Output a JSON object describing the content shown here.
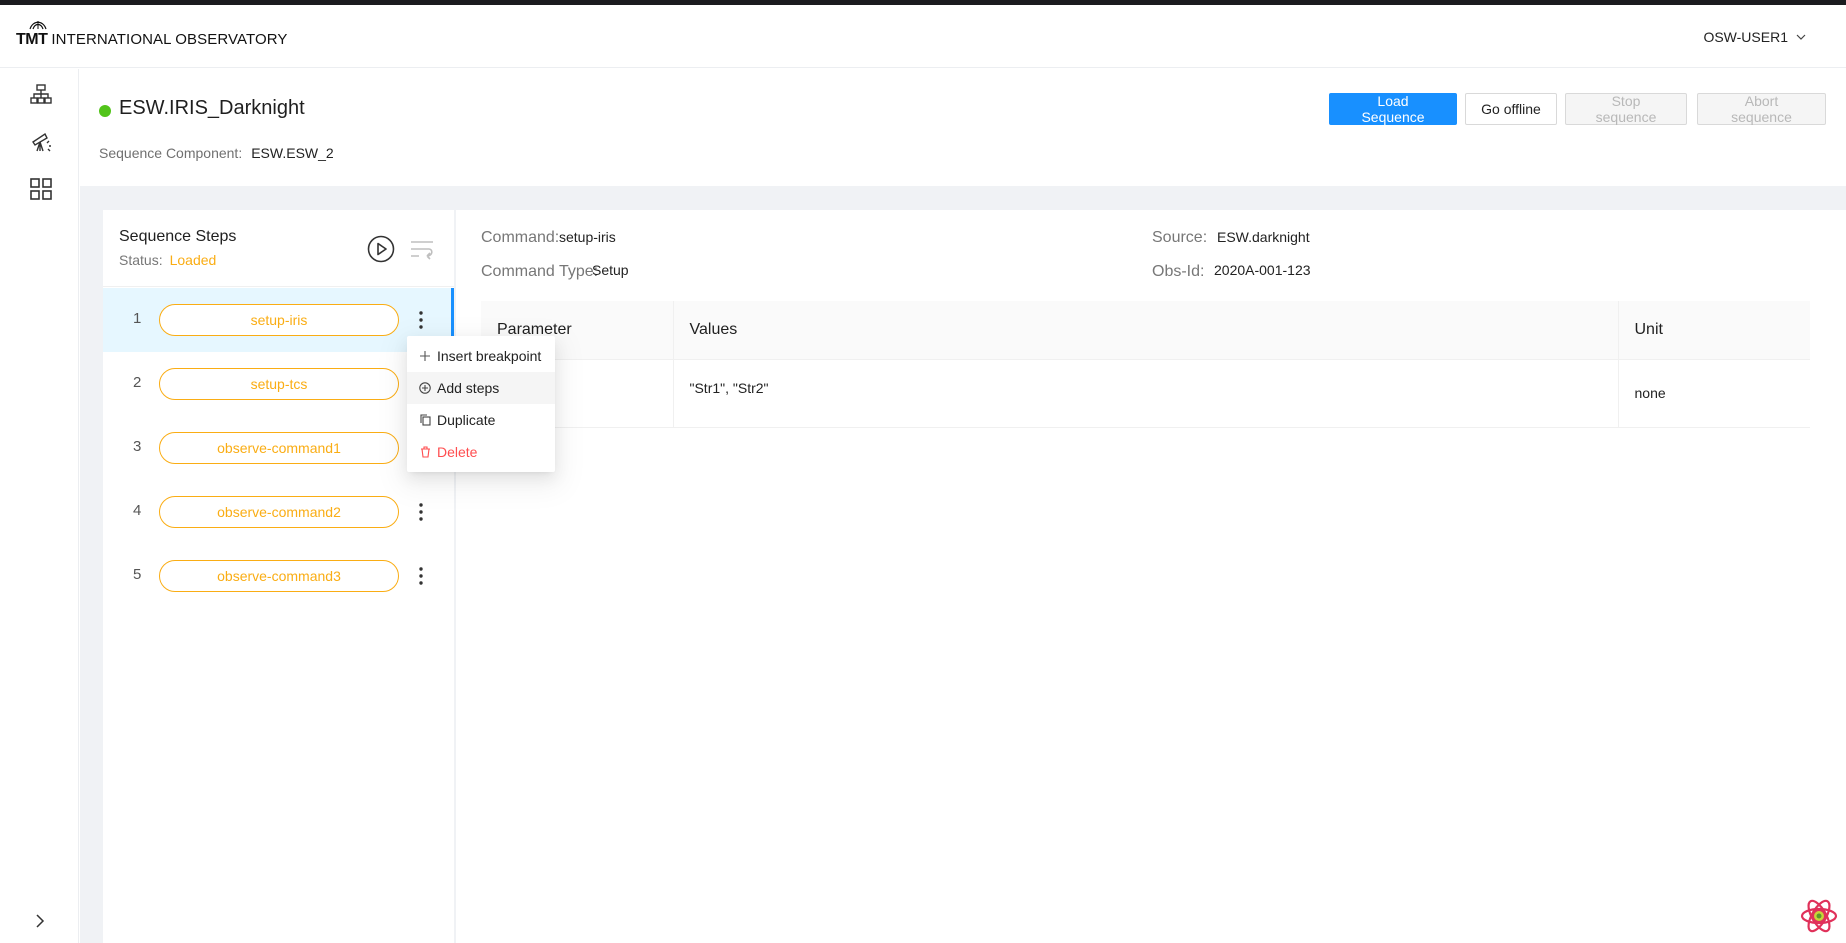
{
  "header": {
    "logo_mark": "TMT",
    "logo_text": "INTERNATIONAL OBSERVATORY",
    "user_label": "OSW-USER1"
  },
  "sidebar": {
    "icons": [
      "hierarchy-icon",
      "telescope-icon",
      "grid-icon"
    ],
    "expand_icon": "chevron-right-icon"
  },
  "sequencer": {
    "title": "ESW.IRIS_Darknight",
    "status_color": "#52c41a",
    "component_label": "Sequence Component:",
    "component_value": "ESW.ESW_2"
  },
  "actions": {
    "load": "Load Sequence",
    "offline": "Go offline",
    "stop": "Stop sequence",
    "abort": "Abort sequence"
  },
  "steps_panel": {
    "title": "Sequence Steps",
    "status_label": "Status:",
    "status_value": "Loaded",
    "steps": [
      {
        "num": "1",
        "name": "setup-iris"
      },
      {
        "num": "2",
        "name": "setup-tcs"
      },
      {
        "num": "3",
        "name": "observe-command1"
      },
      {
        "num": "4",
        "name": "observe-command2"
      },
      {
        "num": "5",
        "name": "observe-command3"
      }
    ]
  },
  "context_menu": {
    "items": [
      {
        "label": "Insert breakpoint",
        "icon": "plus-icon"
      },
      {
        "label": "Add steps",
        "icon": "plus-circle-icon"
      },
      {
        "label": "Duplicate",
        "icon": "copy-icon"
      },
      {
        "label": "Delete",
        "icon": "trash-icon"
      }
    ]
  },
  "details": {
    "command_label": "Command:",
    "command_value": "setup-iris",
    "type_label": "Command Type:",
    "type_value": "Setup",
    "source_label": "Source:",
    "source_value": "ESW.darknight",
    "obsid_label": "Obs-Id:",
    "obsid_value": "2020A-001-123"
  },
  "param_table": {
    "headers": [
      "Parameter",
      "Values",
      "Unit"
    ],
    "rows": [
      {
        "parameter": "",
        "values": "\"Str1\", \"Str2\"",
        "unit": "none"
      }
    ]
  },
  "colors": {
    "primary": "#1890ff",
    "warning": "#faad14",
    "danger": "#ff4d4f",
    "success": "#52c41a"
  }
}
